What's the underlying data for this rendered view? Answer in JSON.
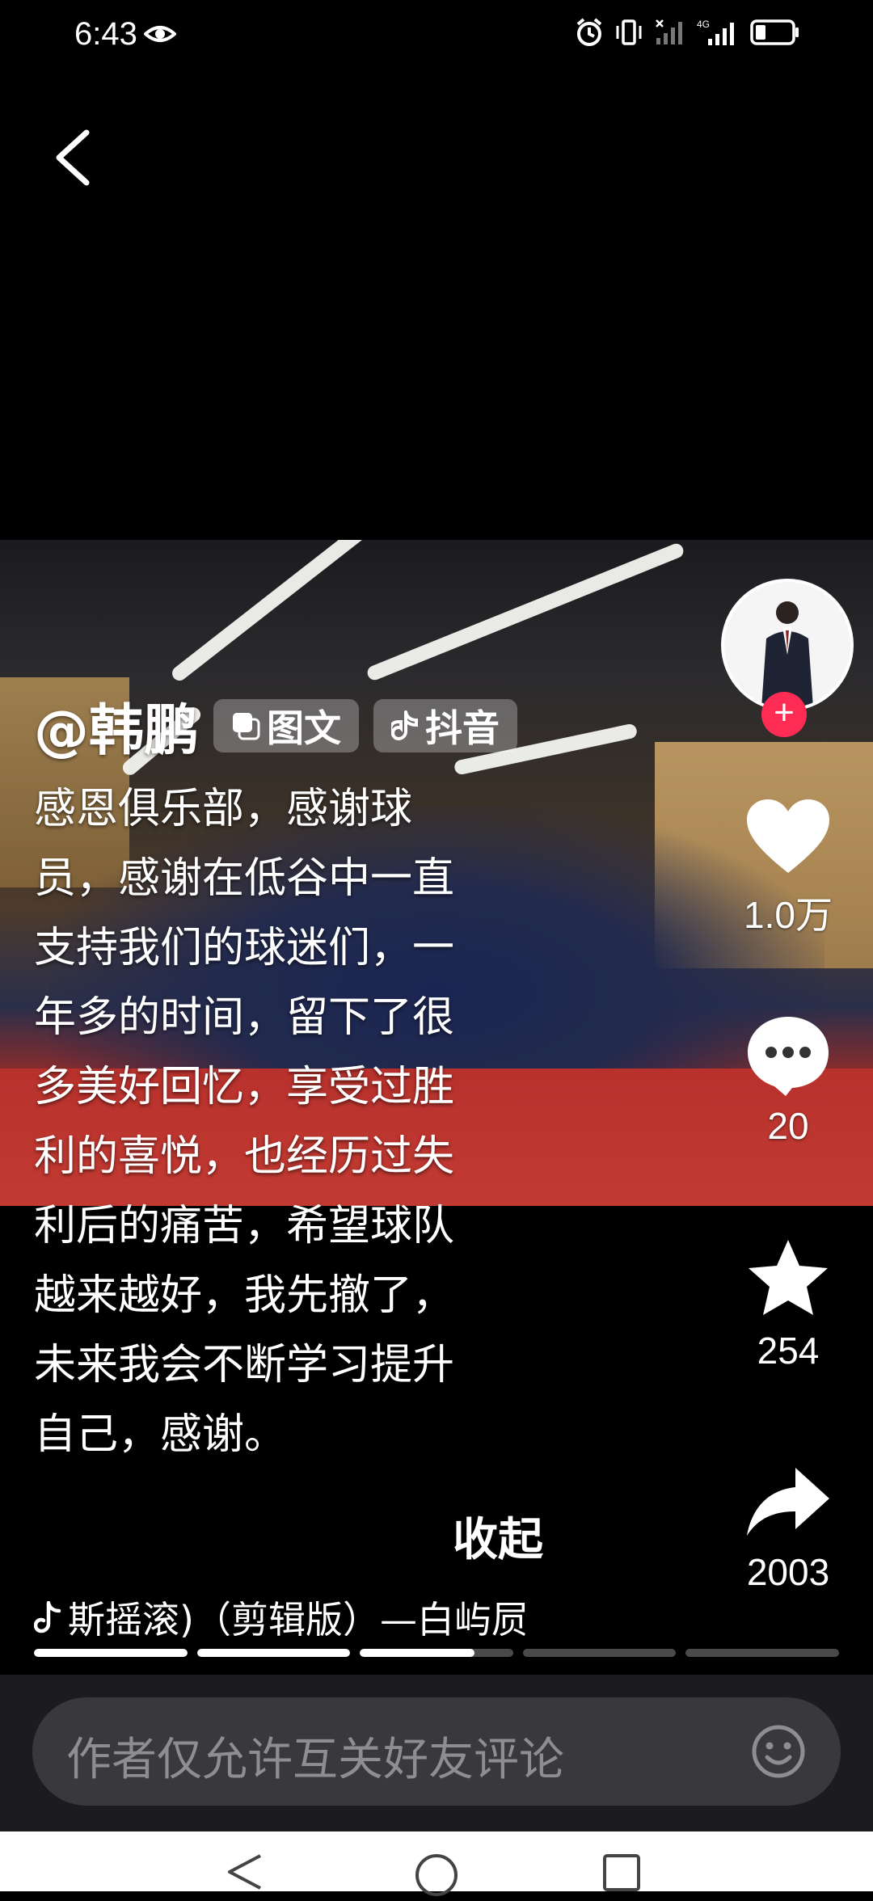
{
  "status_bar": {
    "time": "6:43",
    "network_label": "4G"
  },
  "post": {
    "author": "@韩鹏",
    "tags": [
      {
        "icon": "image-text-icon",
        "label": "图文"
      },
      {
        "icon": "douyin-icon",
        "label": "抖音"
      }
    ],
    "caption_lines": [
      "感恩俱乐部，感谢球",
      "员，感谢在低谷中一直",
      "支持我们的球迷们，一",
      "年多的时间，留下了很",
      "多美好回忆，享受过胜",
      "利的喜悦，也经历过失",
      "利后的痛苦，希望球队",
      "越来越好，我先撤了，",
      "未来我会不断学习提升",
      "自己，感谢。"
    ],
    "collapse_label": "收起",
    "music_text": "斯摇滚)（剪辑版）—白屿屃",
    "progress": [
      1.0,
      1.0,
      0.75,
      0.0,
      0.0
    ]
  },
  "actions": {
    "follow_symbol": "+",
    "like_count": "1.0万",
    "comment_count": "20",
    "favorite_count": "254",
    "share_count": "2003"
  },
  "comment_bar": {
    "placeholder": "作者仅允许互关好友评论"
  },
  "colors": {
    "accent": "#fe2c55",
    "background": "#000000",
    "comment_bar": "#1c1c1e"
  }
}
